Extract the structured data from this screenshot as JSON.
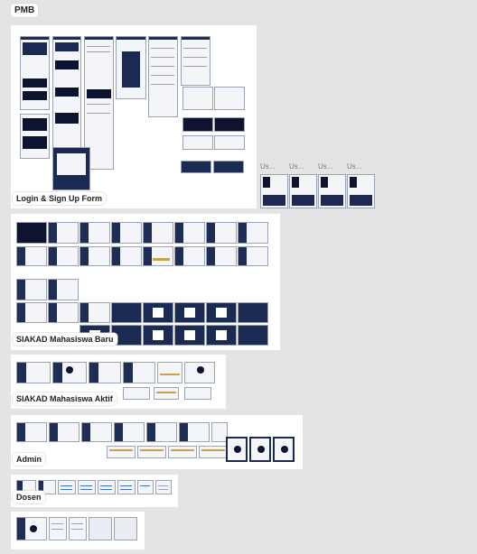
{
  "sections": {
    "pmb": {
      "label": "PMB"
    },
    "login": {
      "label": "Login & Sign Up Form"
    },
    "siakad_baru": {
      "label": "SIAKAD Mahasiswa Baru"
    },
    "siakad_aktif": {
      "label": "SIAKAD Mahasiswa Aktif"
    },
    "admin": {
      "label": "Admin"
    },
    "dosen": {
      "label": "Dosen"
    }
  },
  "user_frames": [
    "Us...",
    "Us...",
    "Us...",
    "Us..."
  ],
  "colors": {
    "canvas": "#e4e4e4",
    "navy": "#1b2a52",
    "gold": "#c8a14a",
    "frame": "#ffffff"
  }
}
